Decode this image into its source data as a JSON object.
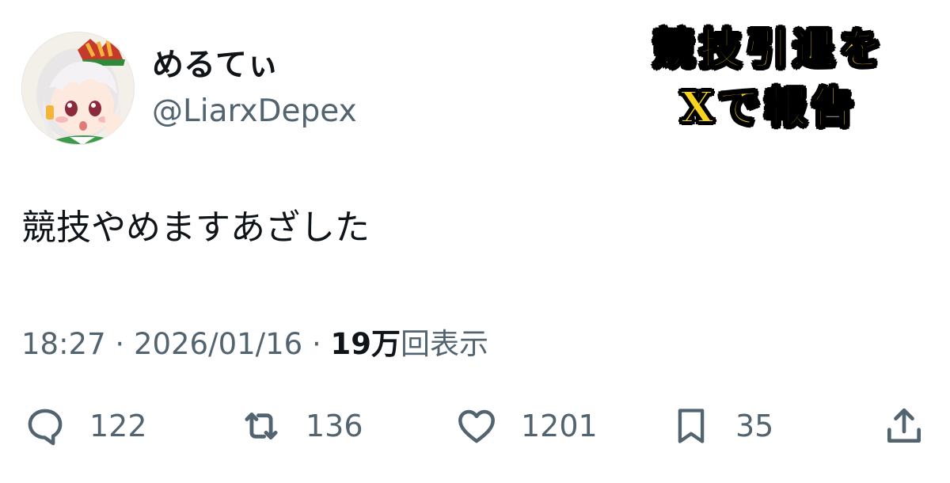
{
  "author": {
    "display_name": "めるてぃ",
    "handle": "@LiarxDepex"
  },
  "overlay": {
    "line1": "競技引退を",
    "line2": "Xで報告",
    "fill_color": "#f7d21f",
    "stroke_color": "#000000"
  },
  "tweet": {
    "text": "競技やめますあざした"
  },
  "meta": {
    "time": "18:27",
    "separator1": " · ",
    "date": "2026/01/16",
    "separator2": " · ",
    "views_count": "19万",
    "views_label": "回表示"
  },
  "actions": {
    "reply": {
      "icon": "speech-bubble-icon",
      "count": "122"
    },
    "retweet": {
      "icon": "repost-arrows-icon",
      "count": "136"
    },
    "like": {
      "icon": "heart-icon",
      "count": "1201"
    },
    "bookmark": {
      "icon": "bookmark-icon",
      "count": "35"
    },
    "share": {
      "icon": "share-upload-icon"
    }
  },
  "colors": {
    "primary_text": "#0f1419",
    "secondary_text": "#536471",
    "background": "#ffffff"
  }
}
